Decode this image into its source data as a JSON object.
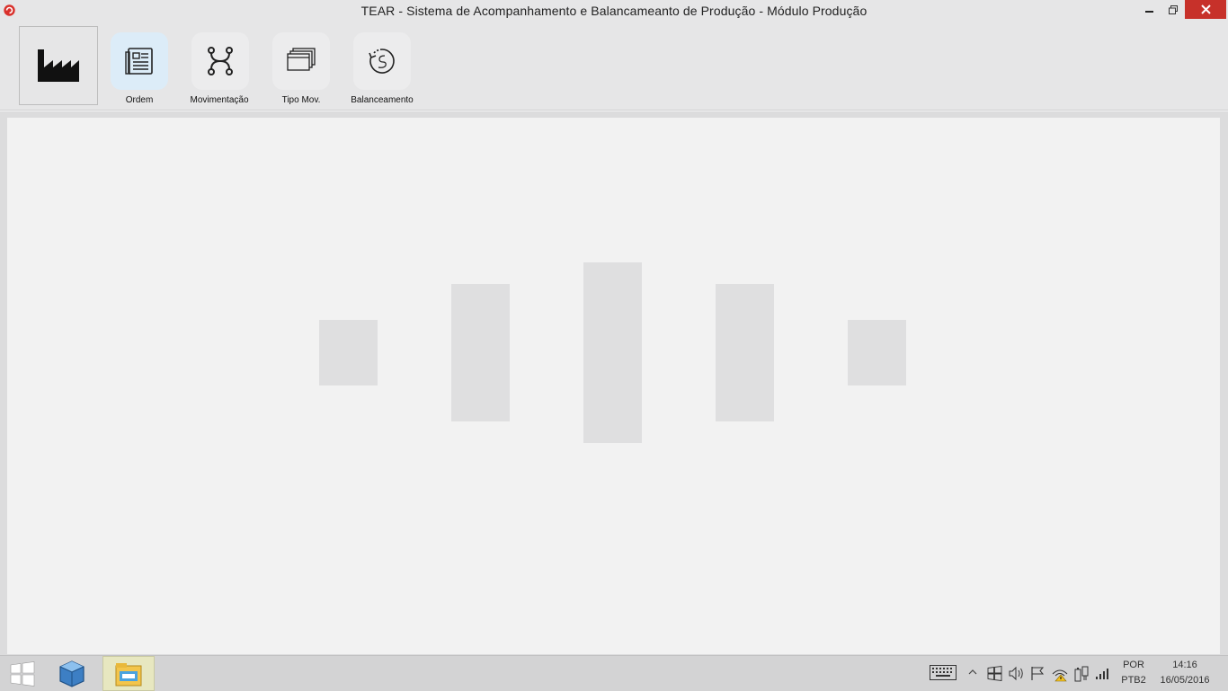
{
  "window": {
    "title": "TEAR - Sistema de Acompanhamento e Balancameanto de Produção - Módulo Produção",
    "minimize_icon": "minimize-icon",
    "restore_icon": "restore-icon",
    "close_icon": "close-icon",
    "close_color": "#c7312a"
  },
  "ribbon": {
    "logo_icon": "factory-icon",
    "buttons": [
      {
        "label": "Ordem",
        "icon": "document-list-icon",
        "active": true
      },
      {
        "label": "Movimentação",
        "icon": "workflow-icon",
        "active": false
      },
      {
        "label": "Tipo Mov.",
        "icon": "stacked-windows-icon",
        "active": false
      },
      {
        "label": "Balanceamento",
        "icon": "refresh-clock-icon",
        "active": false
      }
    ]
  },
  "main": {
    "loading_indicator": "loading-bars"
  },
  "taskbar": {
    "start_icon": "windows-start-icon",
    "pinned": [
      {
        "icon": "virtualbox-cube-icon"
      },
      {
        "icon": "file-explorer-icon",
        "active": true
      }
    ],
    "tray": {
      "icons": [
        "keyboard-icon",
        "show-hidden-icon",
        "action-center-icon",
        "volume-icon",
        "flag-icon",
        "network-warning-icon",
        "power-icon",
        "signal-icon"
      ],
      "language_top": "POR",
      "language_bottom": "PTB2",
      "time": "14:16",
      "date": "16/05/2016"
    }
  }
}
